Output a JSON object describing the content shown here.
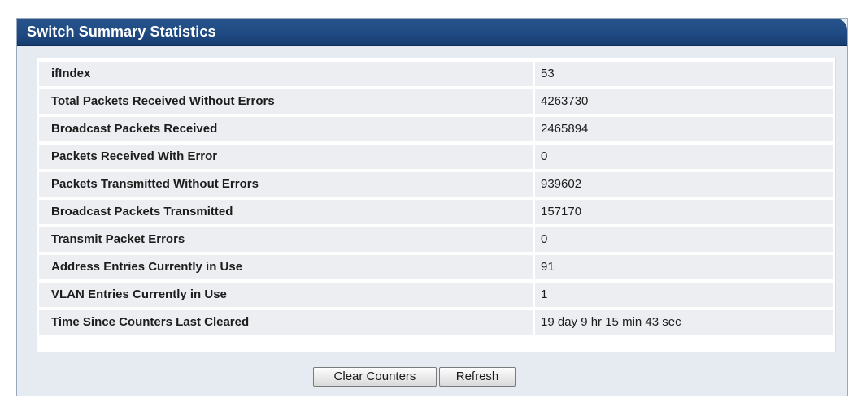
{
  "panel": {
    "title": "Switch Summary Statistics"
  },
  "stats": [
    {
      "label": "ifIndex",
      "value": "53"
    },
    {
      "label": "Total Packets Received Without Errors",
      "value": "4263730"
    },
    {
      "label": "Broadcast Packets Received",
      "value": "2465894"
    },
    {
      "label": "Packets Received With Error",
      "value": "0"
    },
    {
      "label": "Packets Transmitted Without Errors",
      "value": "939602"
    },
    {
      "label": "Broadcast Packets Transmitted",
      "value": "157170"
    },
    {
      "label": "Transmit Packet Errors",
      "value": "0"
    },
    {
      "label": "Address Entries Currently in Use",
      "value": "91"
    },
    {
      "label": "VLAN Entries Currently in Use",
      "value": "1"
    },
    {
      "label": "Time Since Counters Last Cleared",
      "value": "19 day 9 hr 15 min 43 sec"
    }
  ],
  "buttons": {
    "clear_counters": "Clear Counters",
    "refresh": "Refresh"
  },
  "colors": {
    "header_bg": "#1f4a82",
    "panel_bg": "#e6ebf1",
    "row_bg": "#eceef1"
  }
}
